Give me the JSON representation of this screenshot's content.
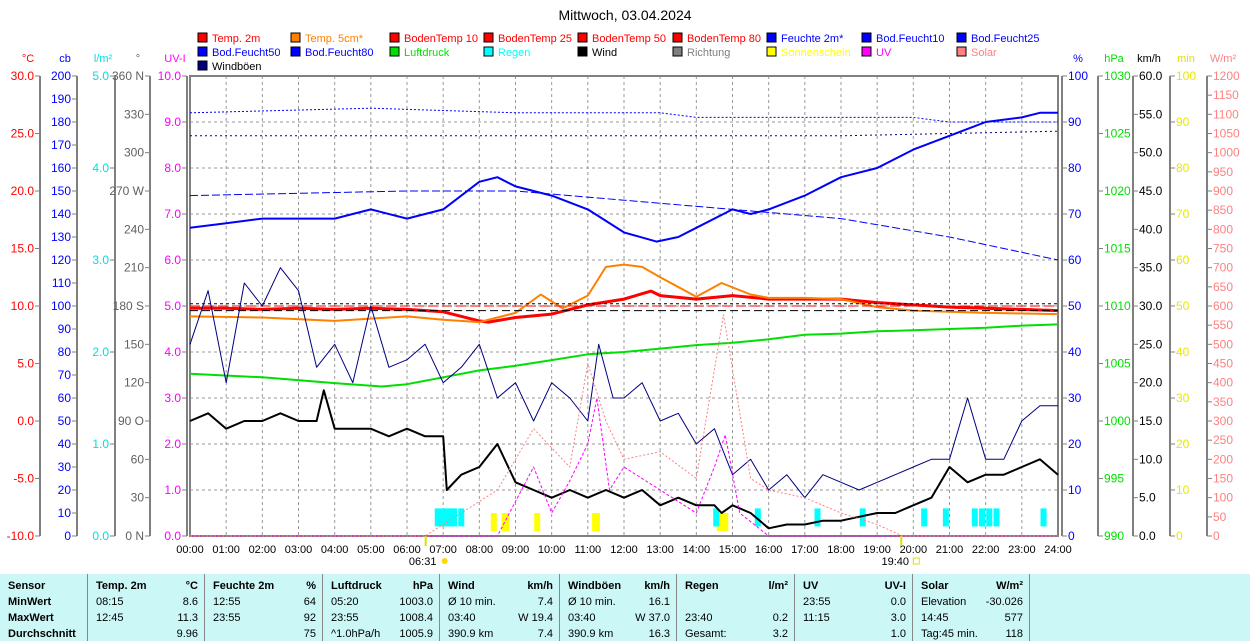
{
  "chart_data": {
    "type": "line",
    "title": "Mittwoch, 03.04.2024",
    "x_ticks": [
      "00:00",
      "01:00",
      "02:00",
      "03:00",
      "04:00",
      "05:00",
      "06:00",
      "07:00",
      "08:00",
      "09:00",
      "10:00",
      "11:00",
      "12:00",
      "13:00",
      "14:00",
      "15:00",
      "16:00",
      "17:00",
      "18:00",
      "19:00",
      "20:00",
      "21:00",
      "22:00",
      "23:00",
      "24:00"
    ],
    "sunrise": "06:31",
    "sunset": "19:40",
    "legend": [
      {
        "name": "Temp. 2m",
        "color": "#ff0000"
      },
      {
        "name": "Temp. 5cm*",
        "color": "#ff8000"
      },
      {
        "name": "BodenTemp 10",
        "color": "#ff0000"
      },
      {
        "name": "BodenTemp 25",
        "color": "#ff0000"
      },
      {
        "name": "BodenTemp 50",
        "color": "#ff0000"
      },
      {
        "name": "BodenTemp 80",
        "color": "#ff0000"
      },
      {
        "name": "Feuchte 2m*",
        "color": "#0000ff"
      },
      {
        "name": "Bod.Feucht10",
        "color": "#0000ff"
      },
      {
        "name": "Bod.Feucht25",
        "color": "#0000ff"
      },
      {
        "name": "Bod.Feucht50",
        "color": "#0000ff"
      },
      {
        "name": "Bod.Feucht80",
        "color": "#0000ff"
      },
      {
        "name": "Luftdruck",
        "color": "#00e000"
      },
      {
        "name": "Regen",
        "color": "#00ffff"
      },
      {
        "name": "Wind",
        "color": "#000000"
      },
      {
        "name": "Richtung",
        "color": "#808080"
      },
      {
        "name": "Sonnenschein",
        "color": "#ffff00"
      },
      {
        "name": "UV",
        "color": "#ff00ff"
      },
      {
        "name": "Solar",
        "color": "#ff8080"
      },
      {
        "name": "Windböen",
        "color": "#000080"
      }
    ],
    "axes": {
      "left": [
        {
          "unit": "°C",
          "min": -10,
          "max": 30,
          "step": 5,
          "dec": 1,
          "color": "#ff0000"
        },
        {
          "unit": "cb",
          "min": 0,
          "max": 200,
          "step": 10,
          "dec": 0,
          "color": "#0000ff"
        },
        {
          "unit": "l/m²",
          "min": 0,
          "max": 5,
          "step": 1,
          "dec": 1,
          "color": "#00e0e0"
        },
        {
          "unit": "°",
          "min": 0,
          "max": 360,
          "step": 30,
          "dec": 0,
          "color": "#606060",
          "compass": {
            "0": "N",
            "90": "O",
            "180": "S",
            "270": "W",
            "360": "N"
          }
        },
        {
          "unit": "UV-I",
          "min": 0,
          "max": 10,
          "step": 1,
          "dec": 1,
          "color": "#ff00ff"
        }
      ],
      "right": [
        {
          "unit": "%",
          "min": 0,
          "max": 100,
          "step": 10,
          "dec": 0,
          "color": "#0000ff"
        },
        {
          "unit": "hPa",
          "min": 990,
          "max": 1030,
          "step": 5,
          "dec": 0,
          "color": "#00e000"
        },
        {
          "unit": "km/h",
          "min": 0,
          "max": 60,
          "step": 5,
          "dec": 1,
          "color": "#000000"
        },
        {
          "unit": "min",
          "min": 0,
          "max": 100,
          "step": 10,
          "dec": 0,
          "color": "#ffff00"
        },
        {
          "unit": "W/m²",
          "min": 0,
          "max": 1200,
          "step": 50,
          "dec": 0,
          "color": "#ff8080"
        }
      ]
    },
    "series": [
      {
        "name": "Temp. 2m",
        "axis": "°C",
        "color": "#ff0000",
        "width": 3,
        "x": [
          0,
          1,
          2,
          3,
          4,
          5,
          6,
          7,
          8,
          8.25,
          9,
          10,
          11,
          12,
          12.75,
          13,
          14,
          15,
          16,
          17,
          18,
          19,
          20,
          21,
          22,
          23,
          24
        ],
        "y": [
          9.8,
          9.8,
          9.7,
          9.8,
          9.7,
          9.8,
          9.7,
          9.5,
          8.7,
          8.6,
          9.0,
          9.3,
          10.1,
          10.6,
          11.3,
          10.9,
          10.6,
          10.9,
          10.6,
          10.6,
          10.6,
          10.3,
          10.1,
          9.9,
          9.8,
          9.7,
          9.6
        ]
      },
      {
        "name": "Temp. 5cm*",
        "axis": "°C",
        "color": "#ff8000",
        "width": 2,
        "x": [
          0,
          2,
          4,
          5,
          6,
          7,
          8,
          9,
          9.7,
          10.3,
          11,
          11.5,
          12,
          12.5,
          13,
          14,
          14.7,
          15.5,
          16,
          17,
          18,
          19,
          20,
          22,
          24
        ],
        "y": [
          9.1,
          9.0,
          8.7,
          8.9,
          9.1,
          8.8,
          8.6,
          9.4,
          11.0,
          9.8,
          10.9,
          13.4,
          13.6,
          13.4,
          12.5,
          10.8,
          12.0,
          11.0,
          10.7,
          10.7,
          10.6,
          9.9,
          9.6,
          9.4,
          9.3
        ]
      },
      {
        "name": "BodenTemp 10",
        "axis": "°C",
        "color": "#ff0000",
        "width": 1,
        "dash": "10,4",
        "x": [
          0,
          24
        ],
        "y": [
          10.0,
          10.0
        ]
      },
      {
        "name": "BodenTemp 25",
        "axis": "°C",
        "color": "#000000",
        "width": 1,
        "dash": "8,4",
        "x": [
          0,
          24
        ],
        "y": [
          9.6,
          9.6
        ]
      },
      {
        "name": "BodenTemp 50",
        "axis": "°C",
        "color": "#000000",
        "width": 1,
        "dash": "3,3",
        "x": [
          0,
          24
        ],
        "y": [
          10.2,
          10.2
        ]
      },
      {
        "name": "Feuchte 2m*",
        "axis": "%",
        "color": "#0000ff",
        "width": 2,
        "x": [
          0,
          1,
          2,
          3,
          4,
          5,
          6,
          7,
          8,
          8.5,
          9,
          10,
          11,
          12,
          12.9,
          13.5,
          14,
          15,
          15.5,
          16,
          17,
          18,
          19,
          20,
          21,
          22,
          23,
          23.5,
          24
        ],
        "y": [
          67,
          68,
          69,
          69,
          69,
          71,
          69,
          71,
          77,
          78,
          76,
          74,
          71,
          66,
          64,
          65,
          67,
          71,
          70,
          71,
          74,
          78,
          80,
          84,
          87,
          90,
          91,
          92,
          92
        ]
      },
      {
        "name": "Bod.Feucht10",
        "axis": "%",
        "color": "#0000ff",
        "width": 1,
        "dash": "2,2",
        "x": [
          0,
          5,
          9,
          13,
          14,
          20,
          21,
          24
        ],
        "y": [
          92,
          93,
          92,
          92,
          91,
          91,
          90,
          90
        ]
      },
      {
        "name": "Bod.Feucht25",
        "axis": "%",
        "color": "#000080",
        "width": 1,
        "dash": "2,3",
        "x": [
          0,
          8,
          14,
          18,
          24
        ],
        "y": [
          87,
          87,
          87,
          87,
          88
        ]
      },
      {
        "name": "Bod.Feucht50",
        "axis": "%",
        "color": "#0000ff",
        "width": 1,
        "dash": "8,3",
        "x": [
          0,
          6,
          9,
          12,
          15,
          18,
          21,
          24
        ],
        "y": [
          74,
          75,
          75,
          73,
          71,
          69,
          65,
          60
        ]
      },
      {
        "name": "Luftdruck",
        "axis": "hPa",
        "color": "#00e000",
        "width": 2,
        "x": [
          0,
          2,
          4,
          5.3,
          6,
          7,
          8,
          9,
          10,
          11,
          12,
          13,
          14,
          15,
          16,
          17,
          18,
          19,
          20,
          21,
          22,
          23,
          24
        ],
        "y": [
          1004.1,
          1003.8,
          1003.3,
          1003.0,
          1003.2,
          1003.8,
          1004.4,
          1004.8,
          1005.3,
          1005.8,
          1006.0,
          1006.3,
          1006.6,
          1006.8,
          1007.1,
          1007.5,
          1007.6,
          1007.8,
          1007.9,
          1008.0,
          1008.1,
          1008.3,
          1008.4
        ]
      },
      {
        "name": "Windböen",
        "axis": "km/h",
        "color": "#000080",
        "width": 1,
        "x": [
          0,
          0.5,
          1,
          1.5,
          2,
          2.5,
          3,
          3.5,
          4,
          4.5,
          5,
          5.5,
          6,
          6.5,
          7,
          7.5,
          8,
          8.5,
          9,
          9.5,
          10,
          10.5,
          11,
          11.3,
          11.7,
          12,
          12.5,
          13,
          13.5,
          14,
          14.5,
          15,
          15.5,
          16,
          16.5,
          17,
          17.5,
          18,
          18.5,
          19,
          19.5,
          20,
          20.5,
          21,
          21.5,
          22,
          22.5,
          23,
          23.5,
          24
        ],
        "y": [
          25,
          32,
          20,
          33,
          30,
          35,
          32,
          22,
          25,
          20,
          30,
          22,
          23,
          25,
          20,
          22,
          25,
          18,
          20,
          15,
          20,
          18,
          15,
          25,
          18,
          18,
          20,
          15,
          16,
          12,
          14,
          8,
          10,
          6,
          8,
          5,
          8,
          7,
          6,
          7,
          8,
          9,
          10,
          10,
          18,
          10,
          10,
          15,
          17,
          17
        ]
      },
      {
        "name": "Wind",
        "axis": "km/h",
        "color": "#000000",
        "width": 2,
        "x": [
          0,
          0.5,
          1,
          1.5,
          2,
          2.5,
          3,
          3.5,
          3.7,
          4,
          4.5,
          5,
          5.5,
          6,
          6.5,
          7,
          7.1,
          7.5,
          8,
          8.5,
          9,
          9.5,
          10,
          10.5,
          11,
          11.5,
          12,
          12.5,
          13,
          13.5,
          14,
          14.5,
          14.7,
          15,
          15.5,
          16,
          16.5,
          17,
          17.5,
          18,
          18.5,
          19,
          19.5,
          20,
          20.5,
          21,
          21.5,
          22,
          22.5,
          23,
          23.5,
          24
        ],
        "y": [
          15,
          16,
          14,
          15,
          15,
          16,
          15,
          15,
          19,
          14,
          14,
          14,
          13,
          14,
          13,
          13,
          6,
          8,
          9,
          12,
          7,
          6,
          5,
          6,
          5,
          6,
          5,
          6,
          4,
          5,
          4,
          4,
          3,
          4,
          3,
          1,
          1.5,
          1.5,
          2,
          2,
          2.5,
          3,
          3,
          4,
          5,
          9,
          7,
          8,
          8,
          9,
          10,
          8
        ]
      },
      {
        "name": "UV",
        "axis": "UV-I",
        "color": "#ff00ff",
        "width": 1,
        "dash": "3,2",
        "x": [
          0,
          8.5,
          9.5,
          10,
          10.5,
          11,
          11.25,
          11.6,
          12,
          13,
          14,
          14.5,
          14.8,
          15.2,
          16,
          24
        ],
        "y": [
          0,
          0,
          1.5,
          0.5,
          1.2,
          2.0,
          3.0,
          1.0,
          1.5,
          1.0,
          0.5,
          1.5,
          2.2,
          0.5,
          0,
          0
        ]
      },
      {
        "name": "Solar",
        "axis": "W/m²",
        "color": "#ff8080",
        "width": 1,
        "dash": "2,2",
        "x": [
          0,
          6.5,
          7.5,
          8.5,
          9.5,
          10.5,
          11,
          11.5,
          12,
          13,
          14,
          14.75,
          15.5,
          16,
          17,
          18,
          19,
          19.7,
          24
        ],
        "y": [
          0,
          0,
          60,
          120,
          280,
          180,
          450,
          300,
          200,
          220,
          150,
          577,
          150,
          120,
          100,
          60,
          30,
          0,
          0
        ]
      }
    ],
    "bars": [
      {
        "name": "Sonnenschein",
        "axis": "min",
        "color": "#ffff00",
        "x": [
          8.4,
          8.7,
          8.75,
          9.6,
          11.2,
          11.25,
          14.65,
          14.75,
          14.8
        ],
        "y": [
          5,
          5,
          5,
          5,
          5,
          5,
          5,
          5,
          5
        ]
      },
      {
        "name": "Regen",
        "axis": "l/m²",
        "color": "#00ffff",
        "x": [
          6.85,
          7.0,
          7.1,
          7.2,
          7.3,
          7.5,
          14.55,
          15.7,
          17.35,
          18.6,
          20.3,
          20.9,
          21.7,
          21.9,
          22.1,
          22.3,
          23.6
        ],
        "y": [
          0.3,
          0.3,
          0.3,
          0.3,
          0.3,
          0.3,
          0.3,
          0.3,
          0.3,
          0.3,
          0.3,
          0.3,
          0.3,
          0.3,
          0.3,
          0.3,
          0.3
        ]
      }
    ]
  },
  "table": {
    "rows": [
      "Sensor",
      "MinWert",
      "MaxWert",
      "Durchschnitt"
    ],
    "columns": [
      {
        "title": "Temp. 2m",
        "unit": "°C",
        "cells": [
          [
            "08:15",
            "8.6"
          ],
          [
            "12:45",
            "11.3"
          ],
          [
            "",
            "9.96"
          ]
        ]
      },
      {
        "title": "Feuchte 2m",
        "unit": "%",
        "cells": [
          [
            "12:55",
            "64"
          ],
          [
            "23:55",
            "92"
          ],
          [
            "",
            "75"
          ]
        ]
      },
      {
        "title": "Luftdruck",
        "unit": "hPa",
        "cells": [
          [
            "05:20",
            "1003.0"
          ],
          [
            "23:55",
            "1008.4"
          ],
          [
            "^1.0hPa/h",
            "1005.9"
          ]
        ]
      },
      {
        "title": "Wind",
        "unit": "km/h",
        "cells": [
          [
            "Ø 10 min.",
            "7.4"
          ],
          [
            "03:40",
            "W 19.4"
          ],
          [
            "390.9 km",
            "7.4"
          ]
        ]
      },
      {
        "title": "Windböen",
        "unit": "km/h",
        "cells": [
          [
            "Ø 10 min.",
            "16.1"
          ],
          [
            "03:40",
            "W 37.0"
          ],
          [
            "390.9 km",
            "16.3"
          ]
        ]
      },
      {
        "title": "Regen",
        "unit": "l/m²",
        "cells": [
          [
            "",
            ""
          ],
          [
            "23:40",
            "0.2"
          ],
          [
            "Gesamt:",
            "3.2"
          ]
        ]
      },
      {
        "title": "UV",
        "unit": "UV-I",
        "cells": [
          [
            "23:55",
            "0.0"
          ],
          [
            "11:15",
            "3.0"
          ],
          [
            "",
            "1.0"
          ]
        ]
      },
      {
        "title": "Solar",
        "unit": "W/m²",
        "cells": [
          [
            "Elevation",
            "-30.026"
          ],
          [
            "14:45",
            "577"
          ],
          [
            "Tag:45 min.",
            "118"
          ]
        ]
      }
    ]
  }
}
